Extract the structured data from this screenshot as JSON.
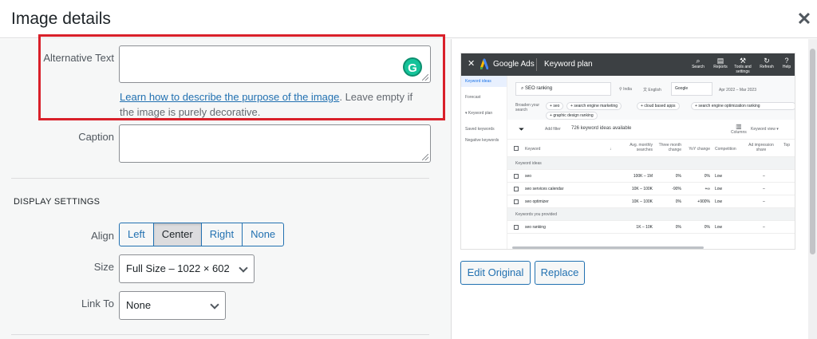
{
  "header": {
    "title": "Image details",
    "close_glyph": "✕"
  },
  "alt_text": {
    "label": "Alternative Text",
    "value": "",
    "help_link": "Learn how to describe the purpose of the image",
    "help_rest": ". Leave empty if the image is purely decorative.",
    "extension_icon": "grammarly-icon",
    "extension_glyph": "G"
  },
  "caption": {
    "label": "Caption",
    "value": ""
  },
  "display_settings": {
    "title": "DISPLAY SETTINGS",
    "align": {
      "label": "Align",
      "options": [
        "Left",
        "Center",
        "Right",
        "None"
      ],
      "selected": "Center"
    },
    "size": {
      "label": "Size",
      "value": "Full Size – 1022 × 602"
    },
    "link_to": {
      "label": "Link To",
      "value": "None"
    }
  },
  "preview": {
    "app_name": "Google Ads",
    "page": "Keyword plan",
    "toolbar": [
      {
        "icon": "search-icon",
        "glyph": "⌕",
        "label": "Search"
      },
      {
        "icon": "reports-icon",
        "glyph": "▤",
        "label": "Reports"
      },
      {
        "icon": "tools-icon",
        "glyph": "⚒",
        "label": "Tools and settings"
      },
      {
        "icon": "refresh-icon",
        "glyph": "↻",
        "label": "Refresh"
      },
      {
        "icon": "help-icon",
        "glyph": "?",
        "label": "Help"
      }
    ],
    "sidebar": [
      "Keyword ideas",
      "Forecast",
      "▾ Keyword plan",
      "Saved keywords",
      "Negative keywords"
    ],
    "search_value": "SEO ranking",
    "location": "India",
    "language": "English",
    "network": "Google",
    "date_range": "Apr 2022 – Mar 2023",
    "broaden_label": "Broaden your search",
    "chips": [
      "seo",
      "search engine marketing",
      "cloud based apps",
      "search engine optimization ranking",
      "graphic design ranking"
    ],
    "filter_label": "Add filter",
    "ideas_count": "726 keyword ideas available",
    "columns_label": "Columns",
    "view_label": "Keyword view",
    "columns": [
      "Keyword",
      "Avg. monthly searches",
      "Three month change",
      "YoY change",
      "Competition",
      "Ad impression share",
      "Top"
    ],
    "groups": [
      {
        "name": "Keyword ideas",
        "rows": [
          {
            "keyword": "seo",
            "searches": "100K – 1M",
            "three_month": "0%",
            "yoy": "0%",
            "competition": "Low",
            "impression": "–"
          },
          {
            "keyword": "seo services calendar",
            "searches": "10K – 100K",
            "three_month": "-90%",
            "yoy": "+∞",
            "competition": "Low",
            "impression": "–"
          },
          {
            "keyword": "seo optimizer",
            "searches": "10K – 100K",
            "three_month": "0%",
            "yoy": "+900%",
            "competition": "Low",
            "impression": "–"
          }
        ]
      },
      {
        "name": "Keywords you provided",
        "rows": [
          {
            "keyword": "seo ranking",
            "searches": "1K – 10K",
            "three_month": "0%",
            "yoy": "0%",
            "competition": "Low",
            "impression": "–"
          }
        ]
      }
    ]
  },
  "actions": {
    "edit_original": "Edit Original",
    "replace": "Replace"
  }
}
